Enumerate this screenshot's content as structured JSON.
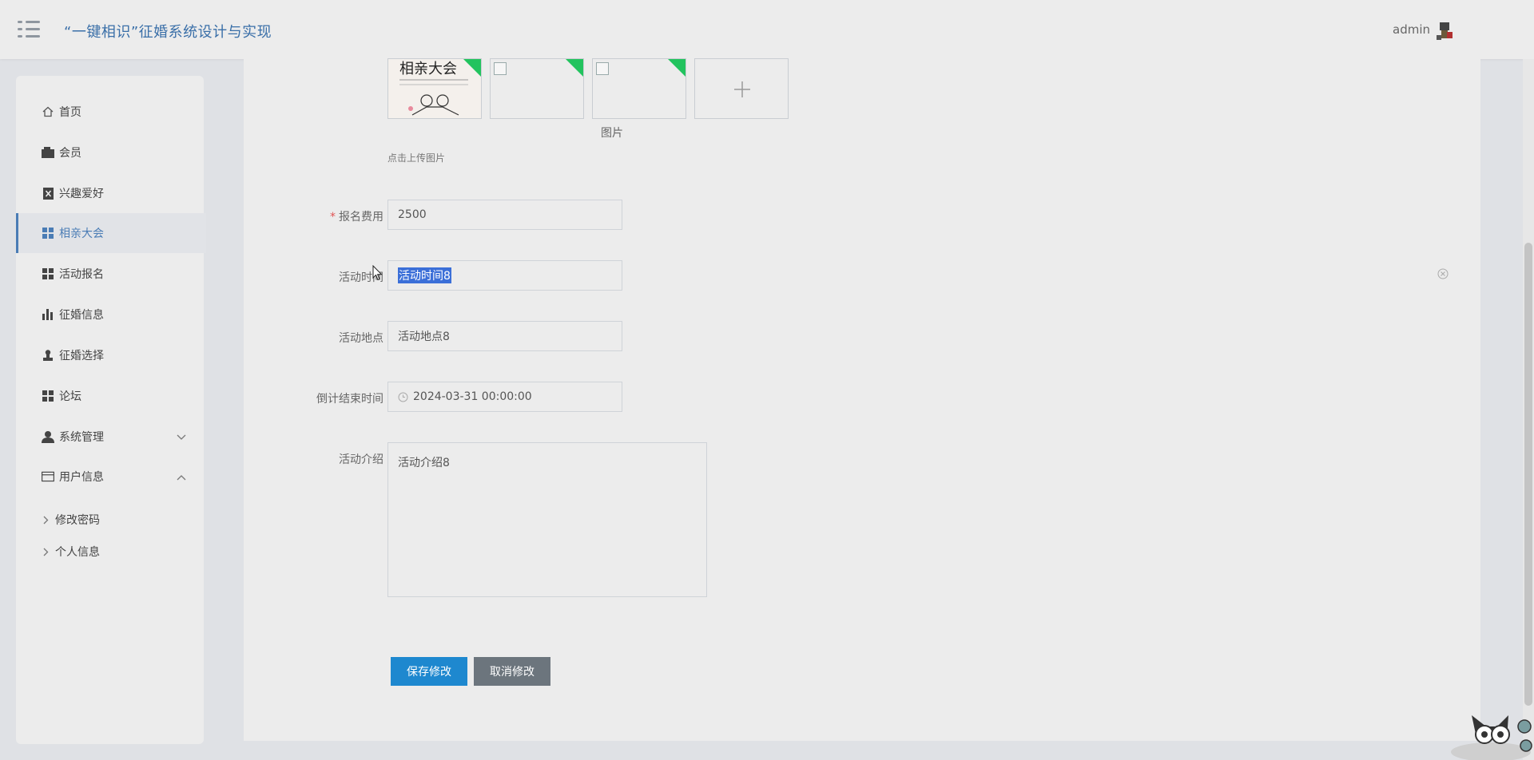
{
  "header": {
    "title": "“一键相识”征婚系统设计与实现",
    "username": "admin"
  },
  "sidebar": {
    "items": [
      {
        "label": "首页",
        "icon": "home-icon"
      },
      {
        "label": "会员",
        "icon": "wallet-icon"
      },
      {
        "label": "兴趣爱好",
        "icon": "clipboard-icon"
      },
      {
        "label": "相亲大会",
        "icon": "grid-icon",
        "active": true
      },
      {
        "label": "活动报名",
        "icon": "grid-icon"
      },
      {
        "label": "征婚信息",
        "icon": "bar-chart-icon"
      },
      {
        "label": "征婚选择",
        "icon": "stamp-icon"
      },
      {
        "label": "论坛",
        "icon": "grid-icon"
      },
      {
        "label": "系统管理",
        "icon": "user-icon",
        "expandable": true
      },
      {
        "label": "用户信息",
        "icon": "card-icon",
        "expanded": true
      }
    ],
    "sub_items": [
      {
        "label": "修改密码"
      },
      {
        "label": "个人信息"
      }
    ]
  },
  "form": {
    "image_label": "图片",
    "upload_tip": "点击上传图片",
    "fee_label": "报名费用",
    "fee_value": "2500",
    "time_label": "活动时间",
    "time_value": "活动时间8",
    "place_label": "活动地点",
    "place_value": "活动地点8",
    "countdown_label": "倒计结束时间",
    "countdown_value": "2024-03-31 00:00:00",
    "intro_label": "活动介绍",
    "intro_value": "活动介绍8",
    "thumbnail_text": "相亲大会",
    "save_label": "保存修改",
    "cancel_label": "取消修改"
  },
  "colors": {
    "accent": "#4a7cb5",
    "save_button": "#1e88cf",
    "cancel_button": "#6c757d",
    "ribbon": "#22c35e",
    "required": "#e05353"
  }
}
